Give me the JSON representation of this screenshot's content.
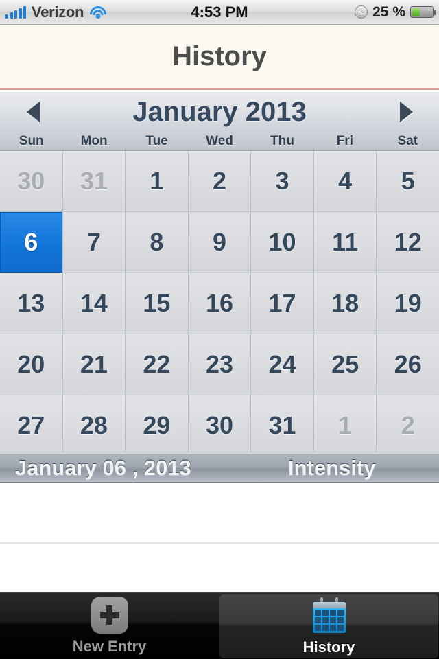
{
  "status_bar": {
    "carrier": "Verizon",
    "signal_icon": "signal-bars-icon",
    "wifi_icon": "wifi-icon",
    "time": "4:53 PM",
    "clock_icon": "alarm-clock-icon",
    "battery_percent": "25 %",
    "battery_icon": "battery-icon",
    "battery_level": 25,
    "battery_color": "#4aa81e"
  },
  "navbar": {
    "title": "History"
  },
  "calendar": {
    "prev_label": "◀",
    "next_label": "▶",
    "month_title": "January 2013",
    "weekdays": [
      "Sun",
      "Mon",
      "Tue",
      "Wed",
      "Thu",
      "Fri",
      "Sat"
    ],
    "selected_color": "#1275d8",
    "days": [
      {
        "n": "30",
        "state": "dim"
      },
      {
        "n": "31",
        "state": "dim"
      },
      {
        "n": "1",
        "state": "normal"
      },
      {
        "n": "2",
        "state": "normal"
      },
      {
        "n": "3",
        "state": "normal"
      },
      {
        "n": "4",
        "state": "normal"
      },
      {
        "n": "5",
        "state": "normal"
      },
      {
        "n": "6",
        "state": "selected"
      },
      {
        "n": "7",
        "state": "normal"
      },
      {
        "n": "8",
        "state": "normal"
      },
      {
        "n": "9",
        "state": "normal"
      },
      {
        "n": "10",
        "state": "normal"
      },
      {
        "n": "11",
        "state": "normal"
      },
      {
        "n": "12",
        "state": "normal"
      },
      {
        "n": "13",
        "state": "normal"
      },
      {
        "n": "14",
        "state": "normal"
      },
      {
        "n": "15",
        "state": "normal"
      },
      {
        "n": "16",
        "state": "normal"
      },
      {
        "n": "17",
        "state": "normal"
      },
      {
        "n": "18",
        "state": "normal"
      },
      {
        "n": "19",
        "state": "normal"
      },
      {
        "n": "20",
        "state": "normal"
      },
      {
        "n": "21",
        "state": "normal"
      },
      {
        "n": "22",
        "state": "normal"
      },
      {
        "n": "23",
        "state": "normal"
      },
      {
        "n": "24",
        "state": "normal"
      },
      {
        "n": "25",
        "state": "normal"
      },
      {
        "n": "26",
        "state": "normal"
      },
      {
        "n": "27",
        "state": "normal"
      },
      {
        "n": "28",
        "state": "normal"
      },
      {
        "n": "29",
        "state": "normal"
      },
      {
        "n": "30",
        "state": "normal"
      },
      {
        "n": "31",
        "state": "normal"
      },
      {
        "n": "1",
        "state": "dim"
      },
      {
        "n": "2",
        "state": "dim"
      }
    ]
  },
  "detail_header": {
    "date": "January 06 , 2013",
    "intensity": "Intensity"
  },
  "entry_list": {
    "items": []
  },
  "tabbar": {
    "tabs": [
      {
        "label": "New Entry",
        "icon": "plus-icon",
        "active": false
      },
      {
        "label": "History",
        "icon": "calendar-icon",
        "active": true
      }
    ]
  }
}
